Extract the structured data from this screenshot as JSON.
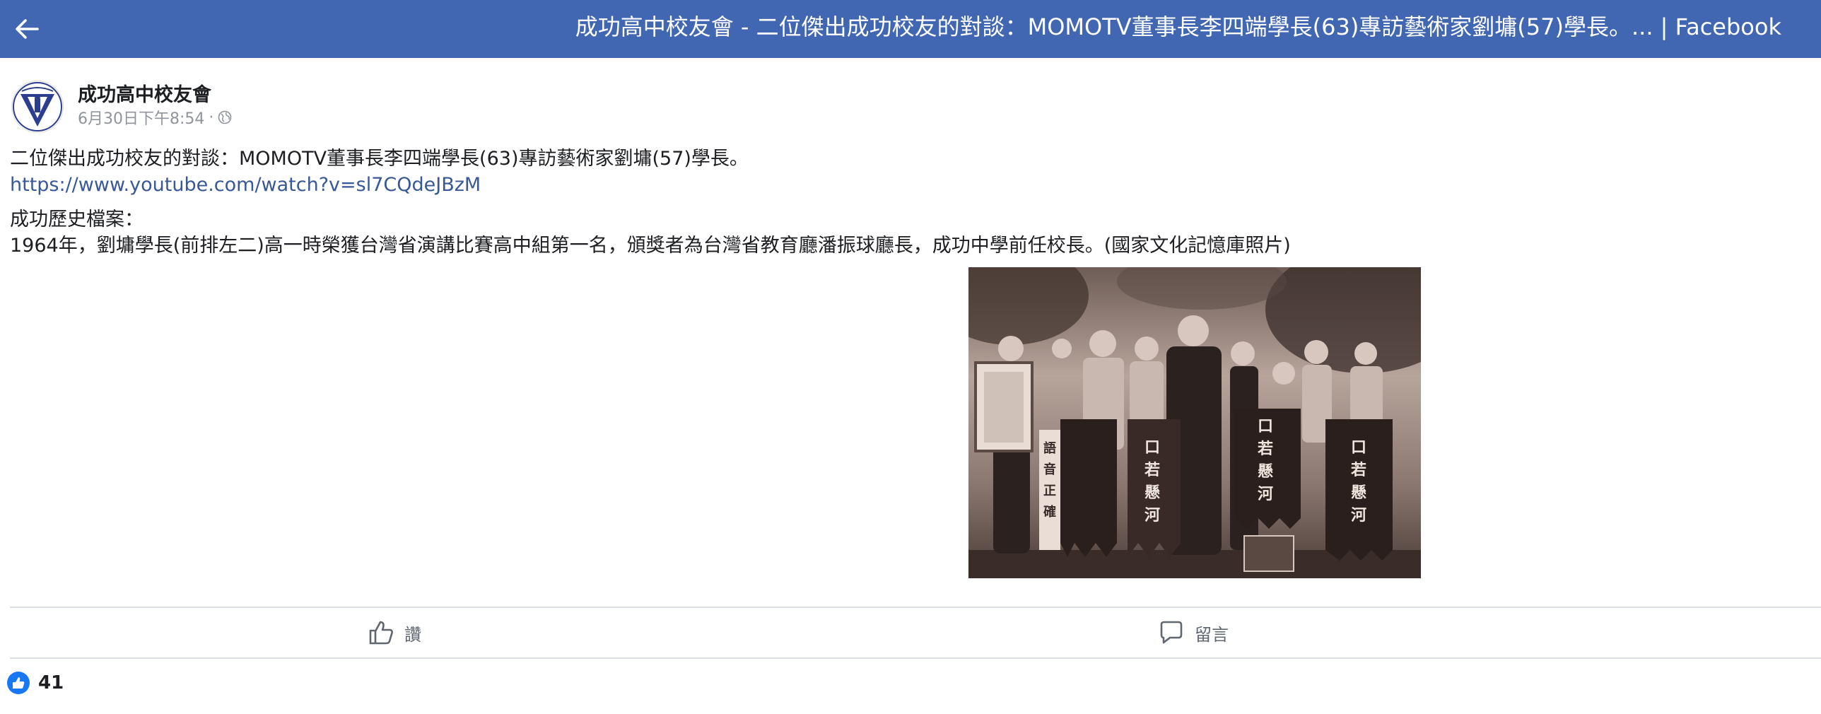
{
  "header": {
    "title": "成功高中校友會 - 二位傑出成功校友的對談：MOMOTV董事長李四端學長(63)專訪藝術家劉墉(57)學長。... | Facebook",
    "back_icon": "arrow-left-icon"
  },
  "post": {
    "author": "成功高中校友會",
    "timestamp": "6月30日下午8:54",
    "separator": "·",
    "privacy_icon": "globe-icon",
    "avatar_icon": "school-crest-icon",
    "line1": "二位傑出成功校友的對談：MOMOTV董事長李四端學長(63)專訪藝術家劉墉(57)學長。",
    "link": "https://www.youtube.com/watch?v=sl7CQdeJBzM",
    "line3": "成功歷史檔案：",
    "line4": "1964年，劉墉學長(前排左二)高一時榮獲台灣省演講比賽高中組第一名，頒獎者為台灣省教育廳潘振球廳長，成功中學前任校長。(國家文化記憶庫照片)",
    "photo_banner_texts": [
      "口若懸河",
      "口若懸河",
      "口若懸河",
      "語音正確"
    ]
  },
  "actions": {
    "like_label": "讚",
    "like_icon": "thumbs-up-icon",
    "comment_label": "留言",
    "comment_icon": "comment-icon"
  },
  "reactions": {
    "count": "41",
    "icon": "like-reaction-icon"
  },
  "colors": {
    "brand": "#4267b2",
    "link": "#385898",
    "meta": "#90949c",
    "divider": "#dadde1"
  }
}
